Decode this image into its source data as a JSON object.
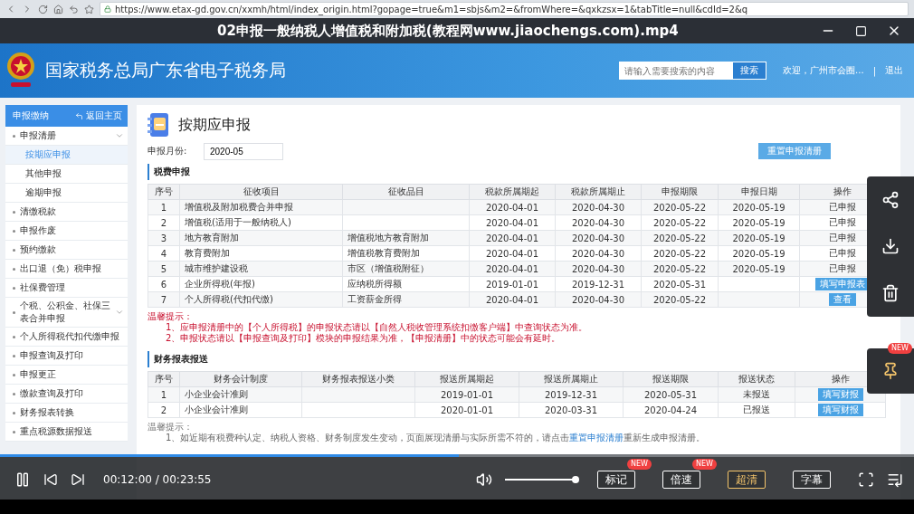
{
  "browser": {
    "url": "https://www.etax-gd.gov.cn/xxmh/html/index_origin.html?gopage=true&m1=sbjs&m2=&fromWhere=&qxkzsx=1&tabTitle=null&cdId=2&q"
  },
  "video_title": "02申报一般纳税人增值税和附加税(教程网www.jiaochengs.com).mp4",
  "header": {
    "site_title": "国家税务总局广东省电子税务局",
    "search": {
      "placeholder": "请输入需要搜索的内容",
      "button": "搜索"
    },
    "welcome": "欢迎，广州市会圈...",
    "separator": "|",
    "logout": "退出"
  },
  "sidebar": {
    "title": "申报缴纳",
    "back": "返回主页",
    "items": [
      {
        "label": "申报清册",
        "kind": "group",
        "children": [
          {
            "label": "按期应申报",
            "selected": true
          },
          {
            "label": "其他申报",
            "selected": false
          },
          {
            "label": "逾期申报",
            "selected": false
          }
        ]
      },
      {
        "label": "清缴税款",
        "kind": "link"
      },
      {
        "label": "申报作废",
        "kind": "link"
      },
      {
        "label": "预约缴款",
        "kind": "link"
      },
      {
        "label": "出口退（免）税申报",
        "kind": "link"
      },
      {
        "label": "社保费管理",
        "kind": "link"
      },
      {
        "label": "个税、公积金、社保三表合并申报",
        "kind": "group"
      },
      {
        "label": "个人所得税代扣代缴申报",
        "kind": "link"
      },
      {
        "label": "申报查询及打印",
        "kind": "link"
      },
      {
        "label": "申报更正",
        "kind": "link"
      },
      {
        "label": "缴款查询及打印",
        "kind": "link"
      },
      {
        "label": "财务报表转换",
        "kind": "link"
      },
      {
        "label": "重点税源数据报送",
        "kind": "link"
      }
    ]
  },
  "page": {
    "title": "按期应申报",
    "month_label": "申报月份:",
    "month_value": "2020-05",
    "reset_button": "重置申报清册"
  },
  "tax_section": {
    "title": "税费申报",
    "columns": [
      "序号",
      "征收项目",
      "征收品目",
      "税款所属期起",
      "税款所属期止",
      "申报期限",
      "申报日期",
      "操作"
    ],
    "rows": [
      {
        "cells": [
          "1",
          "增值税及附加税费合并申报",
          "",
          "2020-04-01",
          "2020-04-30",
          "2020-05-22",
          "2020-05-19"
        ],
        "action": {
          "kind": "status",
          "text": "已申报"
        }
      },
      {
        "cells": [
          "2",
          "增值税(适用于一般纳税人)",
          "",
          "2020-04-01",
          "2020-04-30",
          "2020-05-22",
          "2020-05-19"
        ],
        "action": {
          "kind": "status",
          "text": "已申报"
        }
      },
      {
        "cells": [
          "3",
          "地方教育附加",
          "增值税地方教育附加",
          "2020-04-01",
          "2020-04-30",
          "2020-05-22",
          "2020-05-19"
        ],
        "action": {
          "kind": "status",
          "text": "已申报"
        }
      },
      {
        "cells": [
          "4",
          "教育费附加",
          "增值税教育费附加",
          "2020-04-01",
          "2020-04-30",
          "2020-05-22",
          "2020-05-19"
        ],
        "action": {
          "kind": "status",
          "text": "已申报"
        }
      },
      {
        "cells": [
          "5",
          "城市维护建设税",
          "市区（增值税附征）",
          "2020-04-01",
          "2020-04-30",
          "2020-05-22",
          "2020-05-19"
        ],
        "action": {
          "kind": "status",
          "text": "已申报"
        }
      },
      {
        "cells": [
          "6",
          "企业所得税(年报)",
          "应纳税所得额",
          "2019-01-01",
          "2019-12-31",
          "2020-05-31",
          ""
        ],
        "action": {
          "kind": "button",
          "text": "填写申报表"
        }
      },
      {
        "cells": [
          "7",
          "个人所得税(代扣代缴)",
          "工资薪金所得",
          "2020-04-01",
          "2020-04-30",
          "2020-05-22",
          ""
        ],
        "action": {
          "kind": "button",
          "text": "查看"
        }
      }
    ],
    "notes_title": "温馨提示：",
    "notes": [
      "1、应申报清册中的【个人所得税】的申报状态请以【自然人税收管理系统扣缴客户端】中查询状态为准。",
      "2、申报状态请以【申报查询及打印】模块的申报结果为准，【申报清册】中的状态可能会有延时。"
    ]
  },
  "finance_section": {
    "title": "财务报表报送",
    "columns": [
      "序号",
      "财务会计制度",
      "财务报表报送小类",
      "报送所属期起",
      "报送所属期止",
      "报送期限",
      "报送状态",
      "操作"
    ],
    "rows": [
      {
        "cells": [
          "1",
          "小企业会计准则",
          "",
          "2019-01-01",
          "2019-12-31",
          "2020-05-31",
          "未报送"
        ],
        "action": {
          "kind": "button",
          "text": "填写财报"
        }
      },
      {
        "cells": [
          "2",
          "小企业会计准则",
          "",
          "2020-01-01",
          "2020-03-31",
          "2020-04-24",
          "已报送"
        ],
        "action": {
          "kind": "button",
          "text": "填写财报"
        }
      }
    ],
    "notes_title": "温馨提示：",
    "note_before_link": "1、如近期有税费种认定、纳税人资格、财务制度发生变动，页面展现清册与实际所需不符的，请点击",
    "note_link": "重置申报清册",
    "note_after_link": "重新生成申报清册。"
  },
  "player": {
    "playing": true,
    "progress": {
      "level": 0.502
    },
    "time": "00:12:00 / 00:23:55",
    "volume": {
      "level": 1
    },
    "buttons": [
      {
        "label": "标记",
        "badge": "NEW",
        "selected": false
      },
      {
        "label": "倍速",
        "badge": "NEW",
        "selected": false
      },
      {
        "label": "超清",
        "selected": true
      },
      {
        "label": "字幕",
        "selected": false
      }
    ],
    "side_badge": "NEW"
  }
}
